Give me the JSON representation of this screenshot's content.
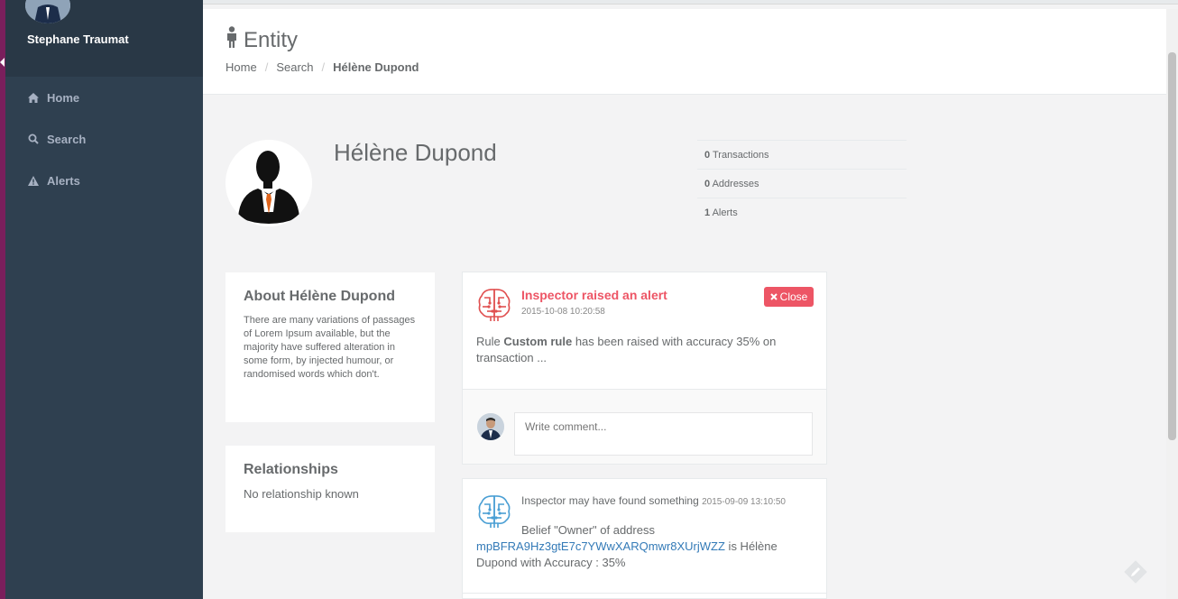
{
  "sidebar": {
    "user_name": "Stephane Traumat",
    "items": [
      {
        "label": "Home",
        "icon": "home-icon"
      },
      {
        "label": "Search",
        "icon": "search-icon"
      },
      {
        "label": "Alerts",
        "icon": "warning-icon"
      }
    ]
  },
  "header": {
    "title": "Entity",
    "breadcrumb": [
      "Home",
      "Search",
      "Hélène Dupond"
    ]
  },
  "entity": {
    "name": "Hélène Dupond",
    "stats": [
      {
        "value": "0",
        "label": "Transactions"
      },
      {
        "value": "0",
        "label": "Addresses"
      },
      {
        "value": "1",
        "label": "Alerts"
      }
    ]
  },
  "about": {
    "title": "About Hélène Dupond",
    "text": "There are many variations of passages of Lorem Ipsum available, but the majority have suffered alteration in some form, by injected humour, or randomised words which don't."
  },
  "relationships": {
    "title": "Relationships",
    "text": "No relationship known"
  },
  "alert": {
    "title": "Inspector raised an alert",
    "time": "2015-10-08 10:20:58",
    "close_label": "Close",
    "body_prefix": "Rule ",
    "rule": "Custom rule",
    "body_suffix": " has been raised with accuracy 35% on transaction ...",
    "comment_placeholder": "Write comment..."
  },
  "finding": {
    "title": "Inspector may have found something",
    "time": "2015-09-09 13:10:50",
    "line1": "Belief \"Owner\" of address",
    "address": "mpBFRA9Hz3gtE7c7YWwXARQmwr8XUrjWZZ",
    "line2": " is Hélène Dupond with Accuracy : 35%"
  },
  "colors": {
    "sidebar": "#2f4050",
    "alert_red": "#ed5565",
    "link_blue": "#337ab7",
    "brain_red": "#e05050",
    "brain_blue": "#4a9fd4"
  }
}
